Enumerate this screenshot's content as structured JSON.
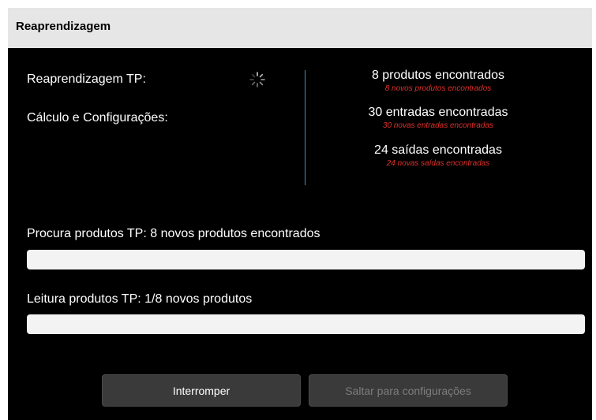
{
  "window": {
    "title": "Reaprendizagem"
  },
  "steps": {
    "relearn_label": "Reaprendizagem TP:",
    "calc_label": "Cálculo e Configurações:"
  },
  "stats": [
    {
      "main": "8 produtos encontrados",
      "sub": "8 novos produtos encontrados"
    },
    {
      "main": "30 entradas encontradas",
      "sub": "30 novas entradas encontradas"
    },
    {
      "main": "24 saídas encontradas",
      "sub": "24 novas saídas encontradas"
    }
  ],
  "progress": [
    {
      "label": "Procura produtos TP: 8 novos produtos encontrados",
      "fraction": 0
    },
    {
      "label": "Leitura produtos TP: 1/8 novos produtos",
      "fraction": 0
    }
  ],
  "buttons": {
    "interrupt": "Interromper",
    "skip": "Saltar para configurações"
  },
  "icons": {
    "spinner": "loading-spinner-icon"
  },
  "colors": {
    "accent_divider": "#3d8fc4",
    "highlight_text": "#e0302a"
  }
}
